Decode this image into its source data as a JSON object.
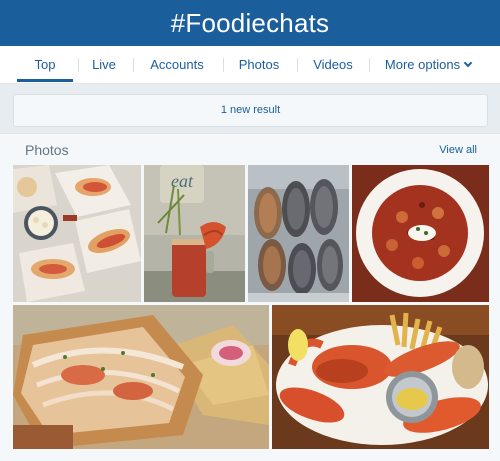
{
  "header": {
    "title": "#Foodiechats"
  },
  "tabs": [
    {
      "label": "Top"
    },
    {
      "label": "Live"
    },
    {
      "label": "Accounts"
    },
    {
      "label": "Photos"
    },
    {
      "label": "Videos"
    },
    {
      "label": "More options"
    }
  ],
  "new_results": {
    "label": "1 new result"
  },
  "photos_section": {
    "title": "Photos",
    "view_all": "View all",
    "cup_text": "eat"
  },
  "colors": {
    "header_bg": "#1b5e9c",
    "accent": "#1b5e9c",
    "page_bg": "#e6ecf0"
  }
}
